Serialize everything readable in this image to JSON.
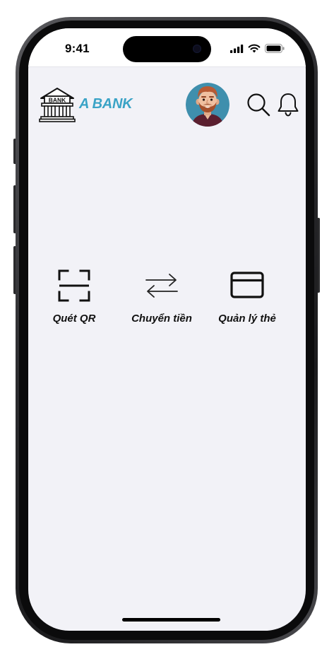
{
  "status_bar": {
    "time": "9:41",
    "icons": [
      "cellular-signal-icon",
      "wifi-icon",
      "battery-icon"
    ]
  },
  "header": {
    "logo_icon": "bank-building-icon",
    "logo_text": "BANK",
    "brand_name": "A BANK",
    "brand_color": "#3aa3c6",
    "avatar_icon": "user-avatar",
    "search_icon": "search-icon",
    "bell_icon": "bell-icon"
  },
  "quick_actions": [
    {
      "label": "Quét QR",
      "icon": "qr-scan-icon"
    },
    {
      "label": "Chuyển tiền",
      "icon": "transfer-arrows-icon"
    },
    {
      "label": "Quản lý thẻ",
      "icon": "card-icon"
    }
  ],
  "colors": {
    "screen_background": "#f2f2f7",
    "header_background": "#ffffff",
    "avatar_background": "#3f8fad"
  }
}
